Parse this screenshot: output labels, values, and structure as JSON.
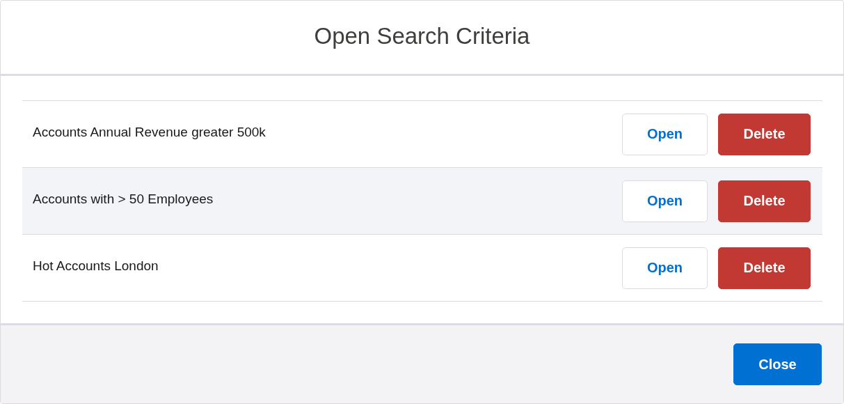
{
  "modal": {
    "title": "Open Search Criteria"
  },
  "criteria": [
    {
      "name": "Accounts Annual Revenue greater 500k",
      "highlighted": false,
      "open_label": "Open",
      "delete_label": "Delete"
    },
    {
      "name": "Accounts with > 50 Employees",
      "highlighted": true,
      "open_label": "Open",
      "delete_label": "Delete"
    },
    {
      "name": "Hot Accounts London",
      "highlighted": false,
      "open_label": "Open",
      "delete_label": "Delete"
    }
  ],
  "footer": {
    "close_label": "Close"
  }
}
